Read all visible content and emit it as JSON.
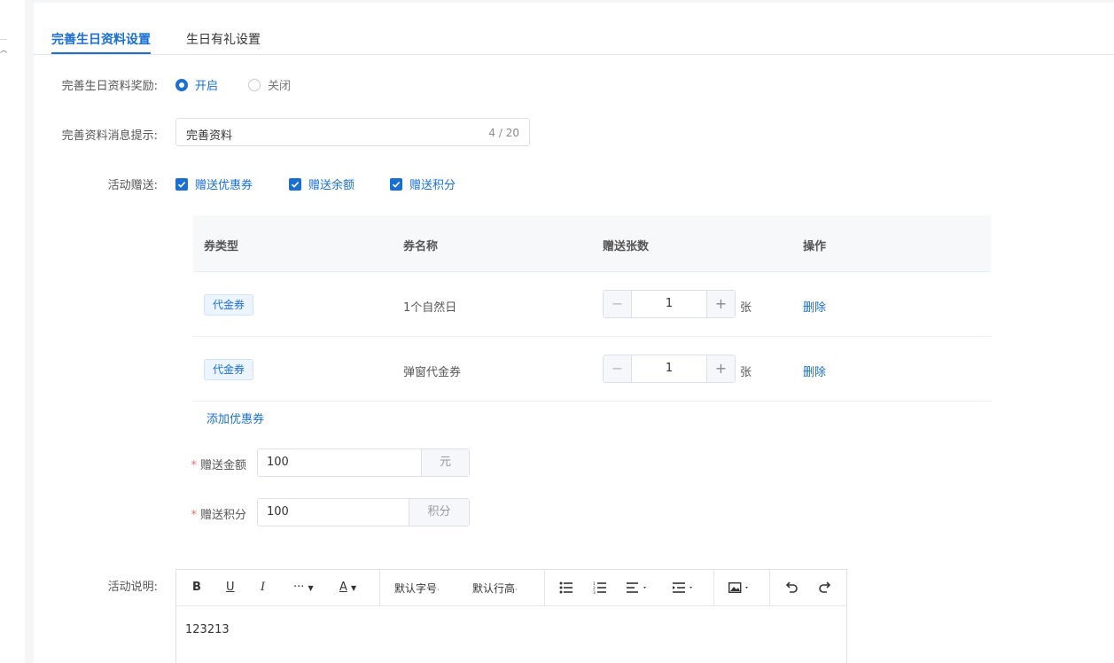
{
  "tabs": [
    {
      "label": "完善生日资料设置",
      "active": true
    },
    {
      "label": "生日有礼设置",
      "active": false
    }
  ],
  "reward": {
    "label": "完善生日资料奖励:",
    "options": [
      "开启",
      "关闭"
    ],
    "selected": "开启"
  },
  "message": {
    "label": "完善资料消息提示:",
    "value": "完善资料",
    "count": "4 / 20"
  },
  "gift": {
    "label": "活动赠送:",
    "options": [
      {
        "label": "赠送优惠券",
        "checked": true
      },
      {
        "label": "赠送余额",
        "checked": true
      },
      {
        "label": "赠送积分",
        "checked": true
      }
    ]
  },
  "coupon_table": {
    "headers": [
      "券类型",
      "券名称",
      "赠送张数",
      "操作"
    ],
    "rows": [
      {
        "type": "代金券",
        "name": "1个自然日",
        "qty": "1",
        "unit": "张",
        "action": "删除"
      },
      {
        "type": "代金券",
        "name": "弹窗代金券",
        "qty": "1",
        "unit": "张",
        "action": "删除"
      }
    ],
    "add_label": "添加优惠券"
  },
  "amount": {
    "required": "*",
    "label": "赠送金额",
    "value": "100",
    "suffix": "元"
  },
  "points": {
    "required": "*",
    "label": "赠送积分",
    "value": "100",
    "suffix": "积分"
  },
  "description": {
    "label": "活动说明:",
    "toolbar": {
      "bold": "B",
      "underline": "U",
      "italic": "I",
      "more": "···",
      "font_color": "A",
      "font_size": "默认字号",
      "line_height": "默认行高"
    },
    "content": "123213"
  },
  "colors": {
    "primary": "#1a6fd1",
    "required": "#f56c6c"
  }
}
